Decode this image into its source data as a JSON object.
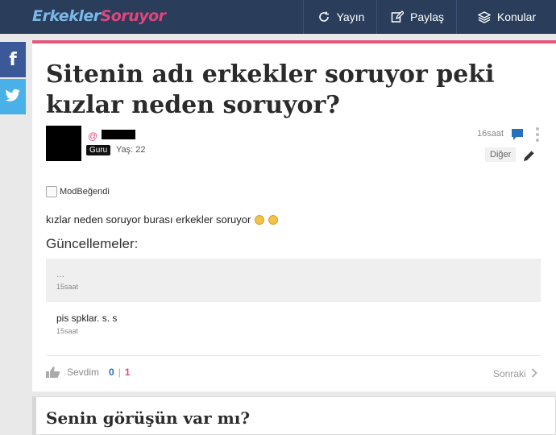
{
  "nav": {
    "logo_part1": "Erkekler",
    "logo_part2": "Soruyor",
    "items": [
      {
        "label": "Yayın",
        "icon": "refresh-icon"
      },
      {
        "label": "Paylaş",
        "icon": "edit-icon"
      },
      {
        "label": "Konular",
        "icon": "layers-icon"
      }
    ]
  },
  "social": {
    "facebook": "f",
    "twitter": "twitter-bird-icon"
  },
  "question": {
    "title": "Sitenin adı erkekler soruyor peki kızlar neden soruyor?",
    "author": {
      "badge": "Guru",
      "age": "Yaş: 22"
    },
    "time": "16saat",
    "category": "Diğer",
    "mod_like_label": "ModBeğendi",
    "body": "kızlar neden soruyor burası erkekler soruyor",
    "updates_title": "Güncellemeler:",
    "updates": [
      {
        "text": "...",
        "time": "15saat"
      },
      {
        "text": "pis spklar. s. s",
        "time": "15saat"
      }
    ],
    "like_label": "Sevdim",
    "like_count": "0",
    "count_separator": "|",
    "other_count": "1",
    "next_label": "Sonraki"
  },
  "opinion": {
    "title": "Senin görüşün var mı?"
  },
  "colors": {
    "nav_bg": "#2a3e5c",
    "accent_pink": "#e5577f",
    "facebook": "#3b5998",
    "twitter": "#4ab1e8",
    "link_blue": "#2a6fbd"
  }
}
